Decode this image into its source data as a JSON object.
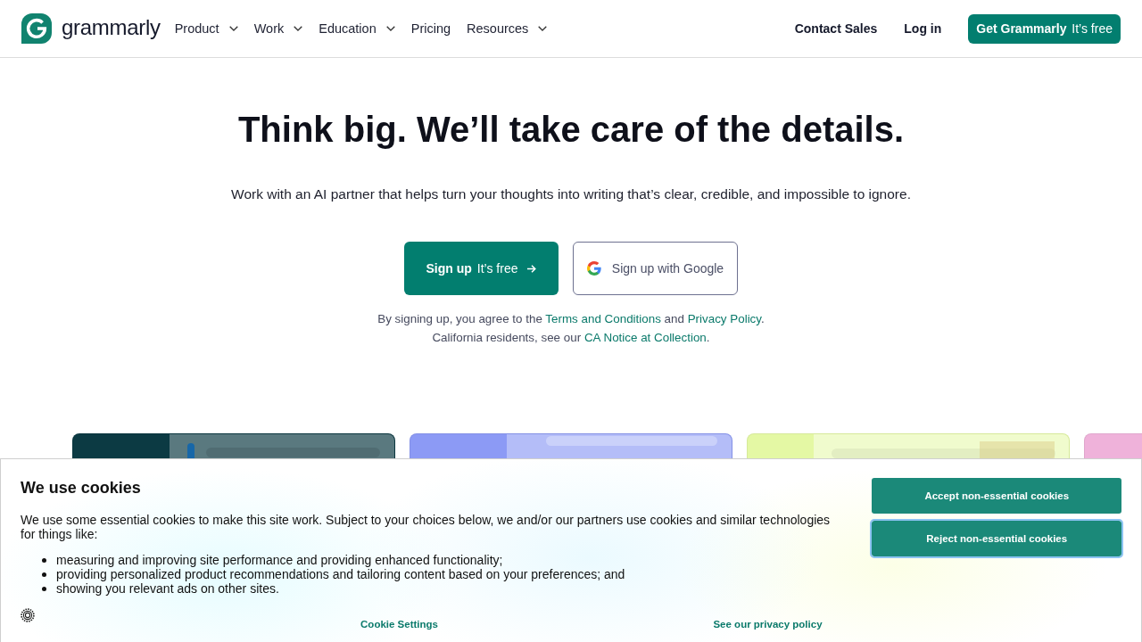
{
  "header": {
    "logo": {
      "wordmark": "grammarly"
    },
    "nav": [
      {
        "label": "Product",
        "has_menu": true
      },
      {
        "label": "Work",
        "has_menu": true
      },
      {
        "label": "Education",
        "has_menu": true
      },
      {
        "label": "Pricing",
        "has_menu": false
      },
      {
        "label": "Resources",
        "has_menu": true
      }
    ],
    "links": [
      "Contact Sales",
      "Log in"
    ],
    "cta": {
      "label": "Get Grammarly",
      "note": "It’s free"
    }
  },
  "hero": {
    "title": "Think big. We’ll take care of the details.",
    "subtitle": "Work with an AI partner that helps turn your thoughts into writing that’s clear, credible, and impossible to ignore.",
    "signup_button": {
      "label": "Sign up",
      "note": "It’s free"
    },
    "google_button": {
      "label": "Sign up with Google"
    },
    "legal": [
      [
        {
          "kind": "text",
          "text": "By signing up, you agree to the "
        },
        {
          "kind": "link",
          "text": "Terms and Conditions"
        },
        {
          "kind": "text",
          "text": " and "
        },
        {
          "kind": "link",
          "text": "Privacy Policy"
        },
        {
          "kind": "text",
          "text": "."
        }
      ],
      [
        {
          "kind": "text",
          "text": "California residents, see our "
        },
        {
          "kind": "link",
          "text": "CA Notice at Collection"
        },
        {
          "kind": "text",
          "text": "."
        }
      ]
    ]
  },
  "preview_cards": [
    {
      "color": "#0c3a43"
    },
    {
      "color": "#8c9af5"
    },
    {
      "color": "#e4f8a4"
    },
    {
      "color": "#efb2da"
    }
  ],
  "cookie_banner": {
    "title": "We use cookies",
    "intro": "We use some essential cookies to make this site work. Subject to your choices below, we and/or our partners use cookies and similar technologies for things like:",
    "items": [
      "measuring and improving site performance and providing enhanced functionality;",
      "providing personalized product recommendations and tailoring content based on your preferences; and",
      "showing you relevant ads on other sites."
    ],
    "buttons": [
      {
        "label": "Accept non-essential cookies",
        "focused": false
      },
      {
        "label": "Reject non-essential cookies",
        "focused": true
      }
    ],
    "links": [
      "Cookie Settings",
      "See our privacy policy"
    ]
  }
}
